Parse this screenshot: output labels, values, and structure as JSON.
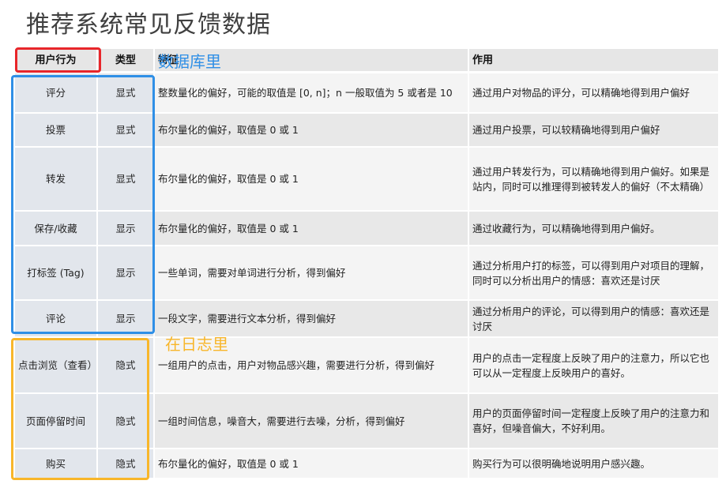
{
  "title": "推荐系统常见反馈数据",
  "headers": {
    "behavior": "用户行为",
    "type": "类型",
    "feature": "特征",
    "effect": "作用"
  },
  "rows": [
    {
      "behavior": "评分",
      "type": "显式",
      "feature": "整数量化的偏好，可能的取值是 [0, n]；n 一般取值为 5 或者是 10",
      "effect": "通过用户对物品的评分，可以精确地得到用户偏好"
    },
    {
      "behavior": "投票",
      "type": "显式",
      "feature": "布尔量化的偏好，取值是 0 或 1",
      "effect": "通过用户投票，可以较精确地得到用户偏好"
    },
    {
      "behavior": "转发",
      "type": "显式",
      "feature": "布尔量化的偏好，取值是 0 或 1",
      "effect": "通过用户转发行为，可以精确地得到用户偏好。如果是站内，同时可以推理得到被转发人的偏好（不太精确）"
    },
    {
      "behavior": "保存/收藏",
      "type": "显示",
      "feature": "布尔量化的偏好，取值是 0 或 1",
      "effect": "通过收藏行为，可以精确地得到用户偏好。"
    },
    {
      "behavior": "打标签 (Tag)",
      "type": "显示",
      "feature": "一些单词，需要对单词进行分析，得到偏好",
      "effect": "通过分析用户打的标签，可以得到用户对项目的理解，同时可以分析出用户的情感：喜欢还是讨厌"
    },
    {
      "behavior": "评论",
      "type": "显示",
      "feature": "一段文字，需要进行文本分析，得到偏好",
      "effect": "通过分析用户的评论，可以得到用户的情感：喜欢还是讨厌"
    },
    {
      "behavior": "点击浏览（查看）",
      "type": "隐式",
      "feature": "一组用户的点击，用户对物品感兴趣，需要进行分析，得到偏好",
      "effect": "用户的点击一定程度上反映了用户的注意力，所以它也可以从一定程度上反映用户的喜好。"
    },
    {
      "behavior": "页面停留时间",
      "type": "隐式",
      "feature": "一组时间信息，噪音大，需要进行去噪，分析，得到偏好",
      "effect": "用户的页面停留时间一定程度上反映了用户的注意力和喜好，但噪音偏大，不好利用。"
    },
    {
      "behavior": "购买",
      "type": "隐式",
      "feature": "布尔量化的偏好，取值是 0 或 1",
      "effect": "购买行为可以很明确地说明用户感兴趣。"
    }
  ],
  "annotations": {
    "database": "数据库里",
    "log": "在日志里"
  },
  "colors": {
    "red_box": "#e8262a",
    "blue_box": "#2f8fe6",
    "orange_box": "#f8b62a"
  }
}
